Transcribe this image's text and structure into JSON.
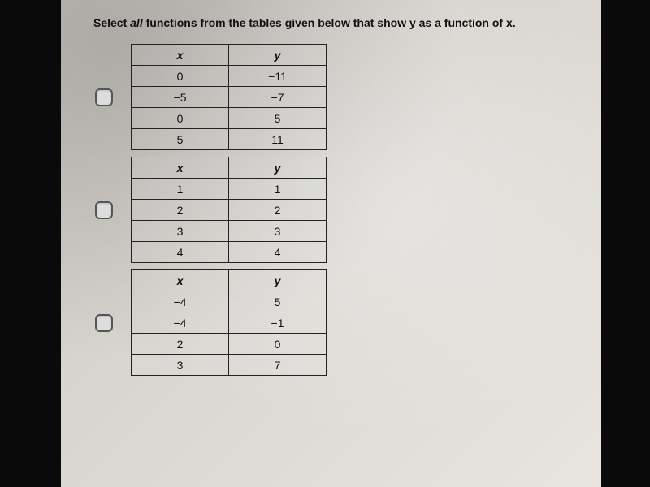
{
  "prompt": {
    "prefix": "Select ",
    "emph": "all",
    "rest": " functions from the tables given below that show y as a function of x."
  },
  "headers": {
    "x": "x",
    "y": "y"
  },
  "tables": [
    {
      "rows": [
        {
          "x": "0",
          "y": "−11"
        },
        {
          "x": "−5",
          "y": "−7"
        },
        {
          "x": "0",
          "y": "5"
        },
        {
          "x": "5",
          "y": "11"
        }
      ]
    },
    {
      "rows": [
        {
          "x": "1",
          "y": "1"
        },
        {
          "x": "2",
          "y": "2"
        },
        {
          "x": "3",
          "y": "3"
        },
        {
          "x": "4",
          "y": "4"
        }
      ]
    },
    {
      "rows": [
        {
          "x": "−4",
          "y": "5"
        },
        {
          "x": "−4",
          "y": "−1"
        },
        {
          "x": "2",
          "y": "0"
        },
        {
          "x": "3",
          "y": "7"
        }
      ]
    }
  ]
}
